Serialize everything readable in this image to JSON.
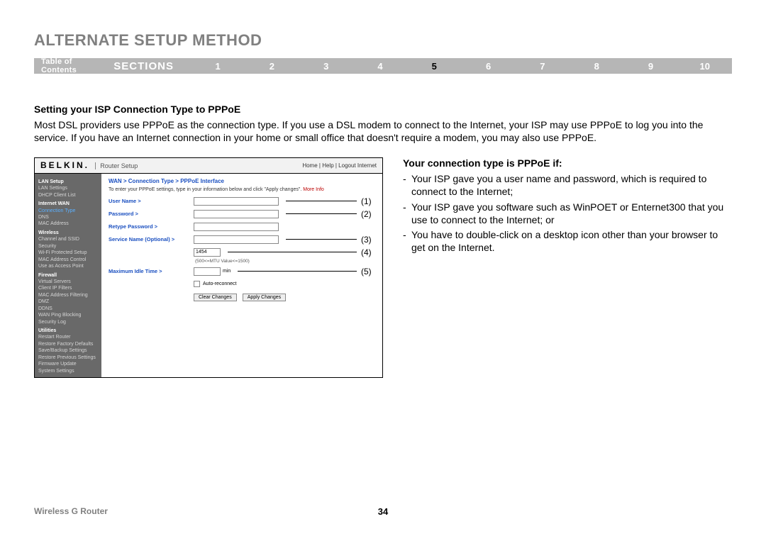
{
  "page_title": "ALTERNATE SETUP METHOD",
  "nav": {
    "toc": "Table of Contents",
    "sections_label": "SECTIONS",
    "numbers": [
      "1",
      "2",
      "3",
      "4",
      "5",
      "6",
      "7",
      "8",
      "9",
      "10"
    ],
    "active_index": 4
  },
  "heading": "Setting your ISP Connection Type to PPPoE",
  "body_paragraph": "Most DSL providers use PPPoE as the connection type. If you use a DSL modem to connect to the Internet, your ISP may use PPPoE to log you into the service. If you have an Internet connection in your home or small office that doesn't require a modem, you may also use PPPoE.",
  "right_heading": "Your connection type is PPPoE if:",
  "bullets": [
    "Your ISP gave you a user name and password, which is required to connect to the Internet;",
    "Your ISP gave you software such as WinPOET or Enternet300 that you use to connect to the Internet; or",
    "You have to double-click on a desktop icon other than your browser to get on the Internet."
  ],
  "router": {
    "brand": "BELKIN.",
    "brand_sub": "Router Setup",
    "top_links": "Home | Help | Logout  Internet",
    "breadcrumb": "WAN > Connection Type > PPPoE Interface",
    "instruction": "To enter your PPPoE settings, type in your information below and click \"Apply changes\". ",
    "more_info": "More Info",
    "sidebar": {
      "groups": [
        {
          "cat": "LAN Setup",
          "items": [
            "LAN Settings",
            "DHCP Client List"
          ]
        },
        {
          "cat": "Internet WAN",
          "items": [
            "Connection Type",
            "DNS",
            "MAC Address"
          ]
        },
        {
          "cat": "Wireless",
          "items": [
            "Channel and SSID",
            "Security",
            "Wi-Fi Protected Setup",
            "MAC Address Control",
            "Use as Access Point"
          ]
        },
        {
          "cat": "Firewall",
          "items": [
            "Virtual Servers",
            "Client IP Filters",
            "MAC Address Filtering",
            "DMZ",
            "DDNS",
            "WAN Ping Blocking",
            "Security Log"
          ]
        },
        {
          "cat": "Utilities",
          "items": [
            "Restart Router",
            "Restore Factory Defaults",
            "Save/Backup Settings",
            "Restore Previous Settings",
            "Firmware Update",
            "System Settings"
          ]
        }
      ],
      "active_item": "Connection Type"
    },
    "form": {
      "user_name_label": "User Name >",
      "password_label": "Password >",
      "retype_password_label": "Retype Password >",
      "service_name_label": "Service Name (Optional) >",
      "mtu_value": "1454",
      "mtu_hint": "(500<=MTU Value<=1500)",
      "max_idle_label": "Maximum Idle Time >",
      "min_suffix": "min",
      "auto_reconnect": "Auto-reconnect",
      "clear_btn": "Clear Changes",
      "apply_btn": "Apply Changes"
    },
    "callouts": [
      "(1)",
      "(2)",
      "(3)",
      "(4)",
      "(5)"
    ]
  },
  "footer": {
    "left": "Wireless G Router",
    "page": "34"
  }
}
